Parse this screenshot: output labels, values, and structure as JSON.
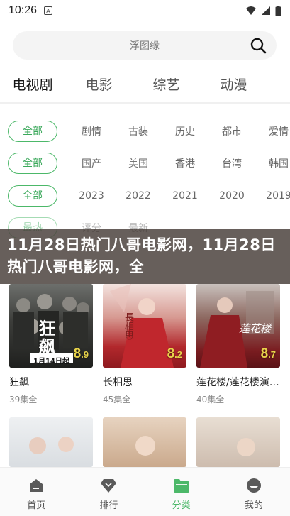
{
  "status": {
    "time": "10:26"
  },
  "search": {
    "placeholder": "浮图缘"
  },
  "main_tabs": [
    {
      "label": "电视剧"
    },
    {
      "label": "电影"
    },
    {
      "label": "综艺"
    },
    {
      "label": "动漫"
    }
  ],
  "filters": {
    "genre": [
      "全部",
      "剧情",
      "古装",
      "历史",
      "都市",
      "爱情"
    ],
    "region": [
      "全部",
      "国产",
      "美国",
      "香港",
      "台湾",
      "韩国"
    ],
    "year": [
      "全部",
      "2023",
      "2022",
      "2021",
      "2020",
      "2019"
    ],
    "sort": [
      "最热",
      "评分",
      "最新"
    ]
  },
  "banner": {
    "text": "11月28日热门八哥电影网，11月28日热门八哥电影网，全"
  },
  "cards": [
    {
      "title": "狂飙",
      "sub": "39集全",
      "score_int": "8",
      "score_dec": ".9",
      "poster_text": "狂飙",
      "poster_date": "1月14日起"
    },
    {
      "title": "长相思",
      "sub": "45集全",
      "score_int": "8",
      "score_dec": ".2",
      "poster_text": "長相思"
    },
    {
      "title": "莲花楼/莲花楼演…",
      "sub": "40集全",
      "score_int": "8",
      "score_dec": ".7",
      "poster_text": "莲花楼"
    },
    {
      "title": "",
      "sub": "",
      "poster_text": ""
    },
    {
      "title": "",
      "sub": "",
      "poster_text": ""
    },
    {
      "title": "",
      "sub": "",
      "poster_text": ""
    }
  ],
  "tabbar": [
    {
      "label": "首页"
    },
    {
      "label": "排行"
    },
    {
      "label": "分类"
    },
    {
      "label": "我的"
    }
  ],
  "colors": {
    "accent": "#4cb869",
    "score": "#e8d34a"
  }
}
